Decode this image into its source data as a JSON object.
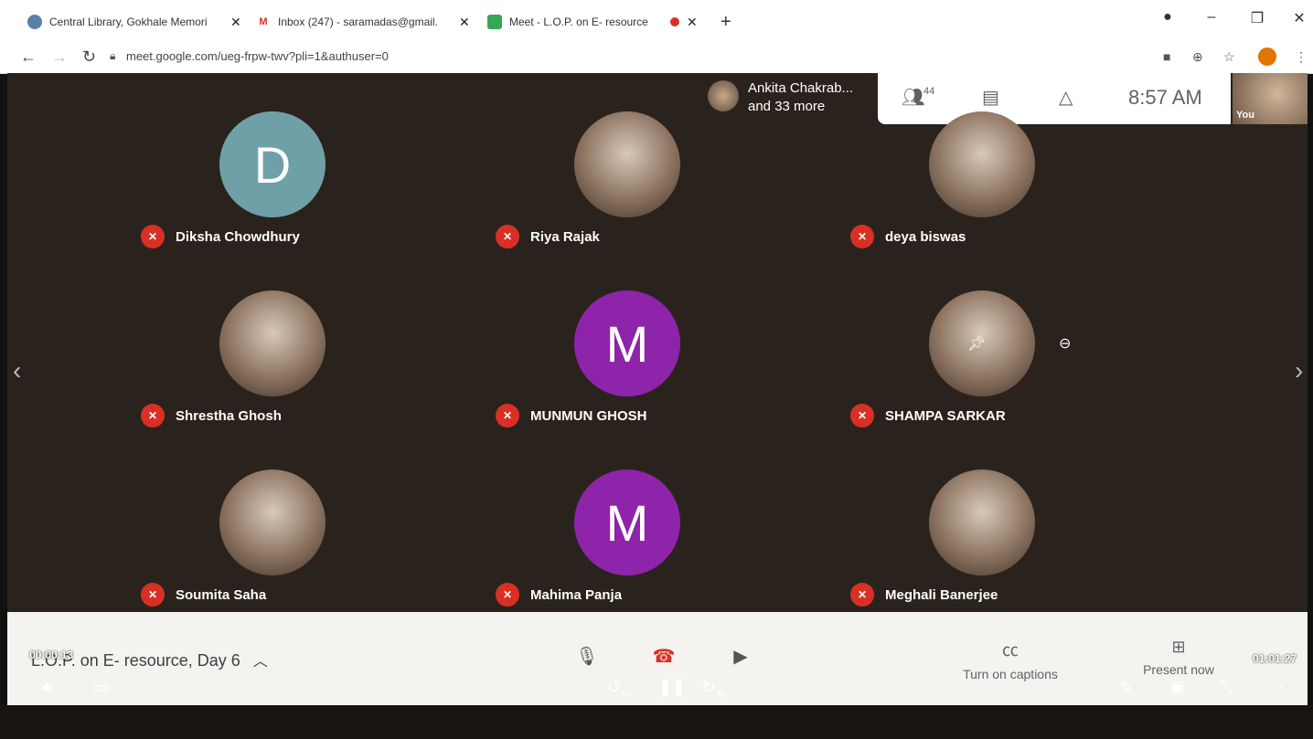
{
  "browser": {
    "tabs": [
      {
        "label": "Central Library, Gokhale Memori",
        "color": "#5b7fa6"
      },
      {
        "label": "Inbox (247) - saramadas@gmail.",
        "color": "#d93025",
        "fav": "M"
      },
      {
        "label": "Meet - L.O.P. on E- resource",
        "color": "#34a853"
      }
    ],
    "new_tab": "+",
    "url": "meet.google.com/ueg-frpw-twv?pli=1&authuser=0"
  },
  "meet": {
    "speaker": {
      "line1": "Ankita Chakrab...",
      "line2": "and 33 more"
    },
    "participant_count": "44",
    "time": "8:57 AM",
    "self_label": "You",
    "tiles": [
      {
        "name": "Diksha Chowdhury",
        "initial": "D",
        "bg": "#6fa0a8"
      },
      {
        "name": "Riya Rajak",
        "initial": "",
        "bg": "photo"
      },
      {
        "name": "deya biswas",
        "initial": "",
        "bg": "photo"
      },
      {
        "name": "Shrestha Ghosh",
        "initial": "",
        "bg": "photo"
      },
      {
        "name": "MUNMUN GHOSH",
        "initial": "M",
        "bg": "#8e24aa"
      },
      {
        "name": "SHAMPA SARKAR",
        "initial": "",
        "bg": "photo"
      },
      {
        "name": "Soumita Saha",
        "initial": "",
        "bg": "photo"
      },
      {
        "name": "Mahima Panja",
        "initial": "M",
        "bg": "#8e24aa"
      },
      {
        "name": "Meghali Banerjee",
        "initial": "",
        "bg": "photo"
      }
    ],
    "meeting_title": "L.O.P. on E- resource, Day 6",
    "captions_label": "Turn on captions",
    "present_label": "Present now"
  },
  "video_player": {
    "elapsed": "00:00:13",
    "duration": "01:01:27",
    "rewind_label": "10",
    "forward_label": "30"
  }
}
